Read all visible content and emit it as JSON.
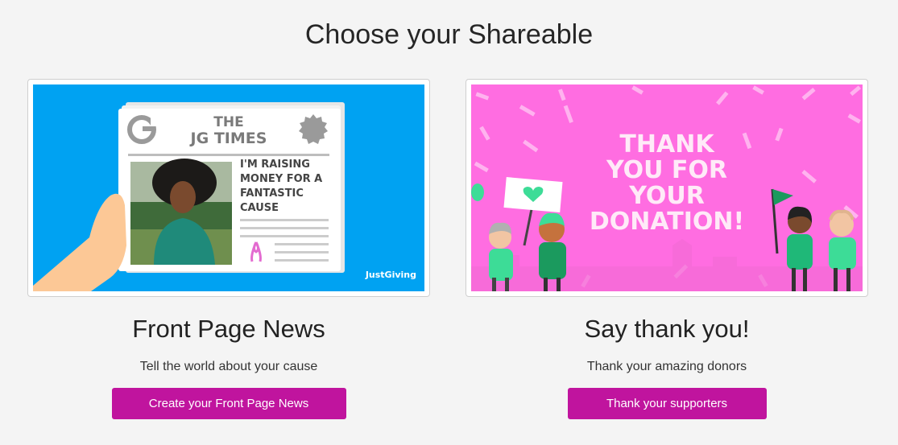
{
  "page": {
    "title": "Choose your Shareable"
  },
  "cards": [
    {
      "image": {
        "paper_title_line1": "THE",
        "paper_title_line2": "JG TIMES",
        "headline_line1": "I'M RAISING",
        "headline_line2": "MONEY FOR A",
        "headline_line3": "FANTASTIC",
        "headline_line4": "CAUSE",
        "brand": "JustGiving",
        "logo_letter": "G",
        "background_color": "#00a2f2"
      },
      "title": "Front Page News",
      "subtitle": "Tell the world about your cause",
      "button_label": "Create your Front Page News"
    },
    {
      "image": {
        "line1": "THANK",
        "line2": "YOU FOR",
        "line3": "YOUR",
        "line4": "DONATION!",
        "background_color": "#ff6de1"
      },
      "title": "Say thank you!",
      "subtitle": "Thank your amazing donors",
      "button_label": "Thank your supporters"
    }
  ],
  "colors": {
    "button": "#c0149e",
    "accent_green": "#3ddc97"
  }
}
